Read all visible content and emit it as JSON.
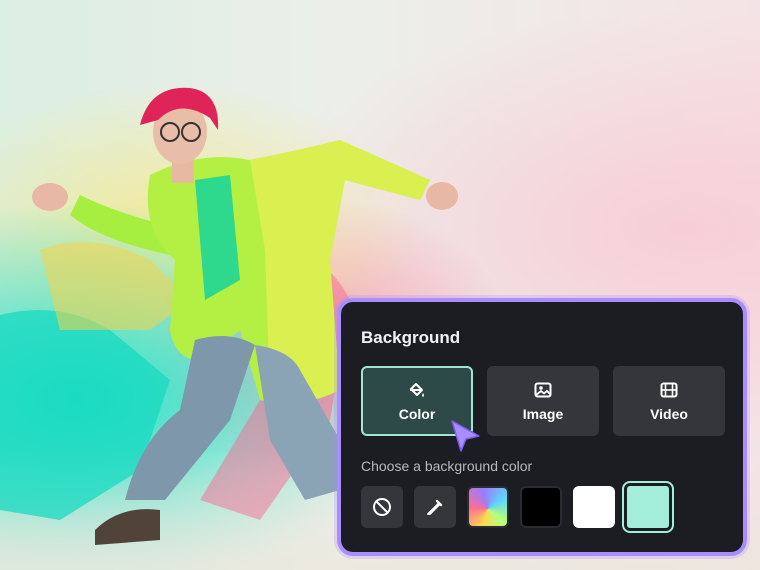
{
  "panel": {
    "title": "Background",
    "subtitle": "Choose a background color",
    "tabs": [
      {
        "label": "Color",
        "icon": "paint-bucket-icon",
        "active": true
      },
      {
        "label": "Image",
        "icon": "image-icon",
        "active": false
      },
      {
        "label": "Video",
        "icon": "film-icon",
        "active": false
      }
    ],
    "swatches": [
      {
        "name": "no-color",
        "icon": "no-color-icon"
      },
      {
        "name": "eyedropper",
        "icon": "eyedropper-icon"
      },
      {
        "name": "gradient",
        "color": "gradient"
      },
      {
        "name": "black",
        "color": "#000000"
      },
      {
        "name": "white",
        "color": "#ffffff"
      },
      {
        "name": "mint",
        "color": "#a3eedb",
        "selected": true
      }
    ]
  },
  "colors": {
    "panel_bg": "#1c1d22",
    "panel_border": "#a98dff",
    "tab_bg": "#35363c",
    "active_tab_border": "#9fe6d6",
    "cursor": "#a98dff"
  }
}
